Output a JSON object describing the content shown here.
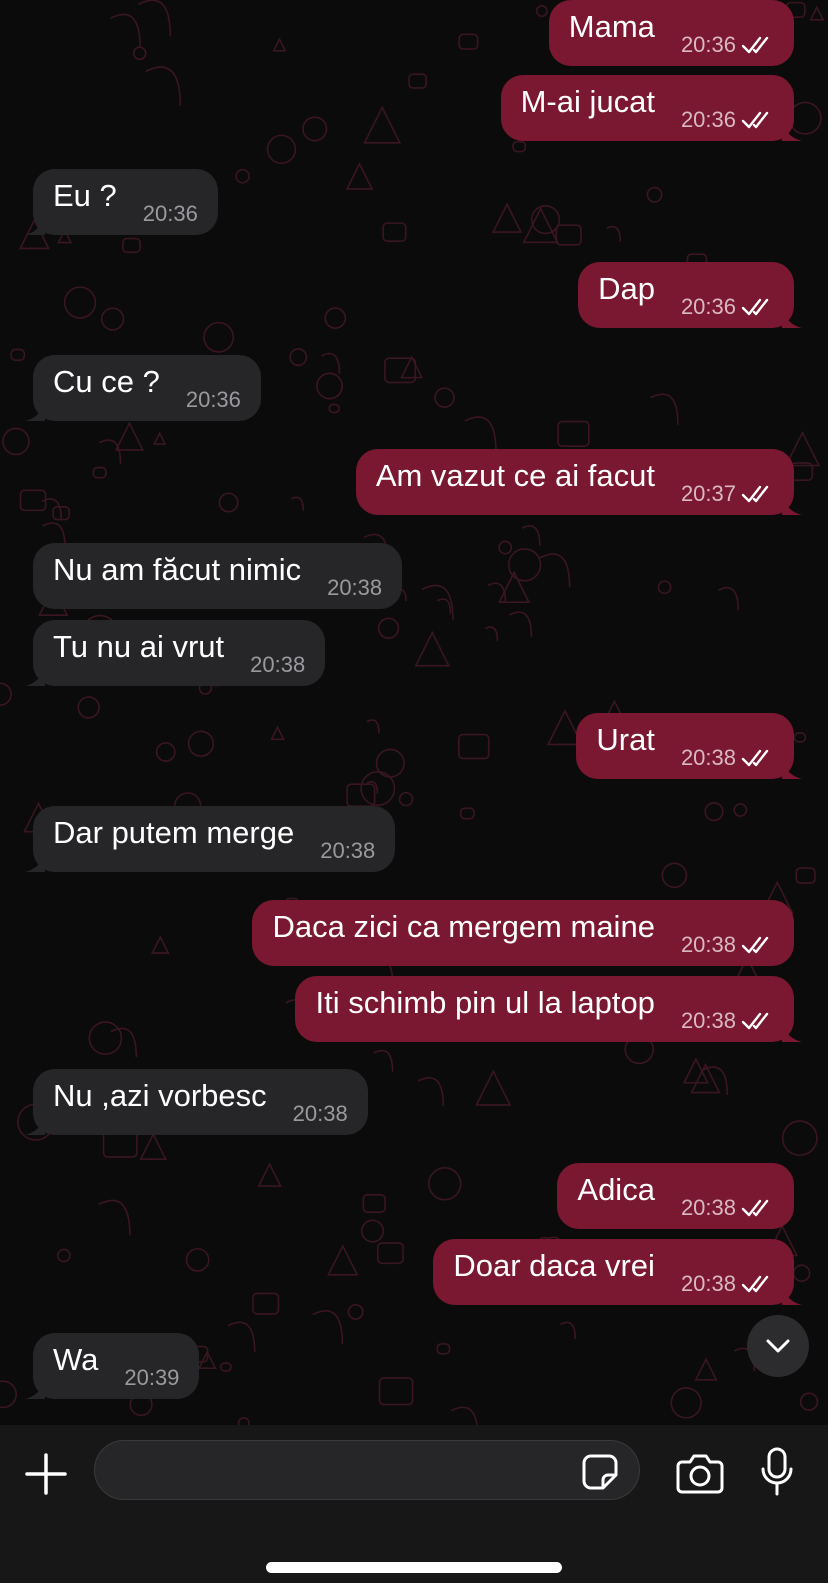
{
  "theme": {
    "background": "#0b0b0b",
    "incoming_bubble": "#262628",
    "outgoing_bubble": "#7a1731",
    "read_ticks": "#ffffff",
    "wallpaper_doodle": "#3a1620"
  },
  "messages": [
    {
      "direction": "out",
      "text": "Mama",
      "time": "20:36",
      "status": "read"
    },
    {
      "direction": "out",
      "text": "M-ai jucat",
      "time": "20:36",
      "status": "read"
    },
    {
      "direction": "in",
      "text": "Eu ?",
      "time": "20:36"
    },
    {
      "direction": "out",
      "text": "Dap",
      "time": "20:36",
      "status": "read"
    },
    {
      "direction": "in",
      "text": "Cu ce ?",
      "time": "20:36"
    },
    {
      "direction": "out",
      "text": "Am vazut ce ai facut",
      "time": "20:37",
      "status": "read"
    },
    {
      "direction": "in",
      "text": "Nu am făcut nimic",
      "time": "20:38"
    },
    {
      "direction": "in",
      "text": "Tu nu ai vrut",
      "time": "20:38"
    },
    {
      "direction": "out",
      "text": "Urat",
      "time": "20:38",
      "status": "read"
    },
    {
      "direction": "in",
      "text": "Dar putem merge",
      "time": "20:38"
    },
    {
      "direction": "out",
      "text": "Daca zici ca mergem maine",
      "time": "20:38",
      "status": "read"
    },
    {
      "direction": "out",
      "text": "Iti schimb pin ul la laptop",
      "time": "20:38",
      "status": "read"
    },
    {
      "direction": "in",
      "text": "Nu ,azi vorbesc",
      "time": "20:38"
    },
    {
      "direction": "out",
      "text": "Adica",
      "time": "20:38",
      "status": "read"
    },
    {
      "direction": "out",
      "text": "Doar daca vrei",
      "time": "20:38",
      "status": "read"
    },
    {
      "direction": "in",
      "text": "Wa",
      "time": "20:39"
    }
  ],
  "composer": {
    "input_value": "",
    "plus_icon": "plus-icon",
    "sticker_icon": "sticker-icon",
    "camera_icon": "camera-icon",
    "mic_icon": "microphone-icon"
  },
  "scroll_down_icon": "chevron-down-icon"
}
